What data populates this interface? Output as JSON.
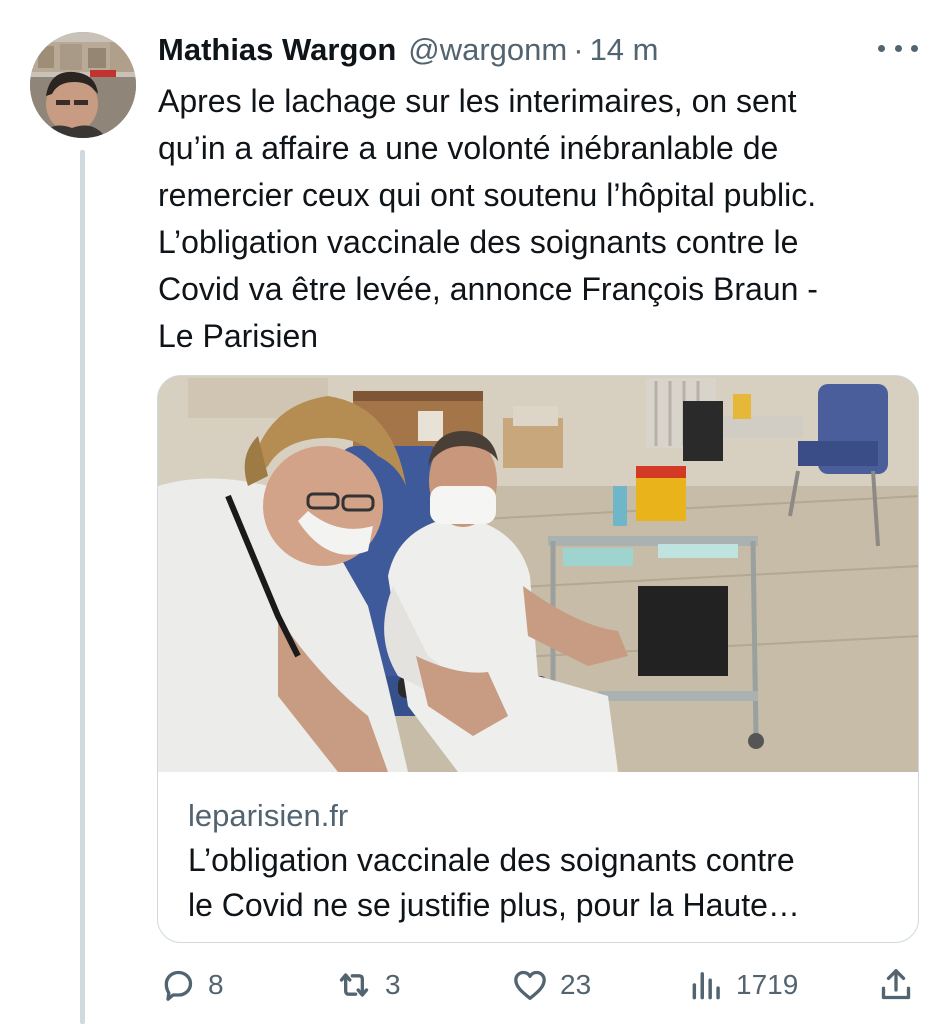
{
  "tweet": {
    "author": {
      "name": "Mathias Wargon",
      "handle": "@wargonm",
      "separator": "·",
      "time": "14 m",
      "avatar_icon": "profile-photo"
    },
    "text_lines": [
      "Apres le lachage sur les interimaires, on sent",
      "qu’in a affaire a une volonté inébranlable de",
      "remercier ceux qui ont soutenu l’hôpital public.",
      "L’obligation vaccinale des soignants contre le",
      "Covid va être levée, annonce François Braun -",
      "Le Parisien"
    ],
    "more_icon": "more-horizontal-icon"
  },
  "card": {
    "image_icon": "article-photo",
    "domain": "leparisien.fr",
    "title_lines": [
      "L’obligation vaccinale des soignants contre",
      "le Covid ne se justifie plus, pour la Haute…"
    ]
  },
  "actions": {
    "reply": {
      "icon": "reply-icon",
      "count": "8"
    },
    "retweet": {
      "icon": "retweet-icon",
      "count": "3"
    },
    "like": {
      "icon": "heart-icon",
      "count": "23"
    },
    "views": {
      "icon": "views-icon",
      "count": "1719"
    },
    "share": {
      "icon": "share-icon"
    }
  },
  "colors": {
    "text_primary": "#0f1419",
    "text_secondary": "#536471",
    "border": "#cfd9de"
  }
}
